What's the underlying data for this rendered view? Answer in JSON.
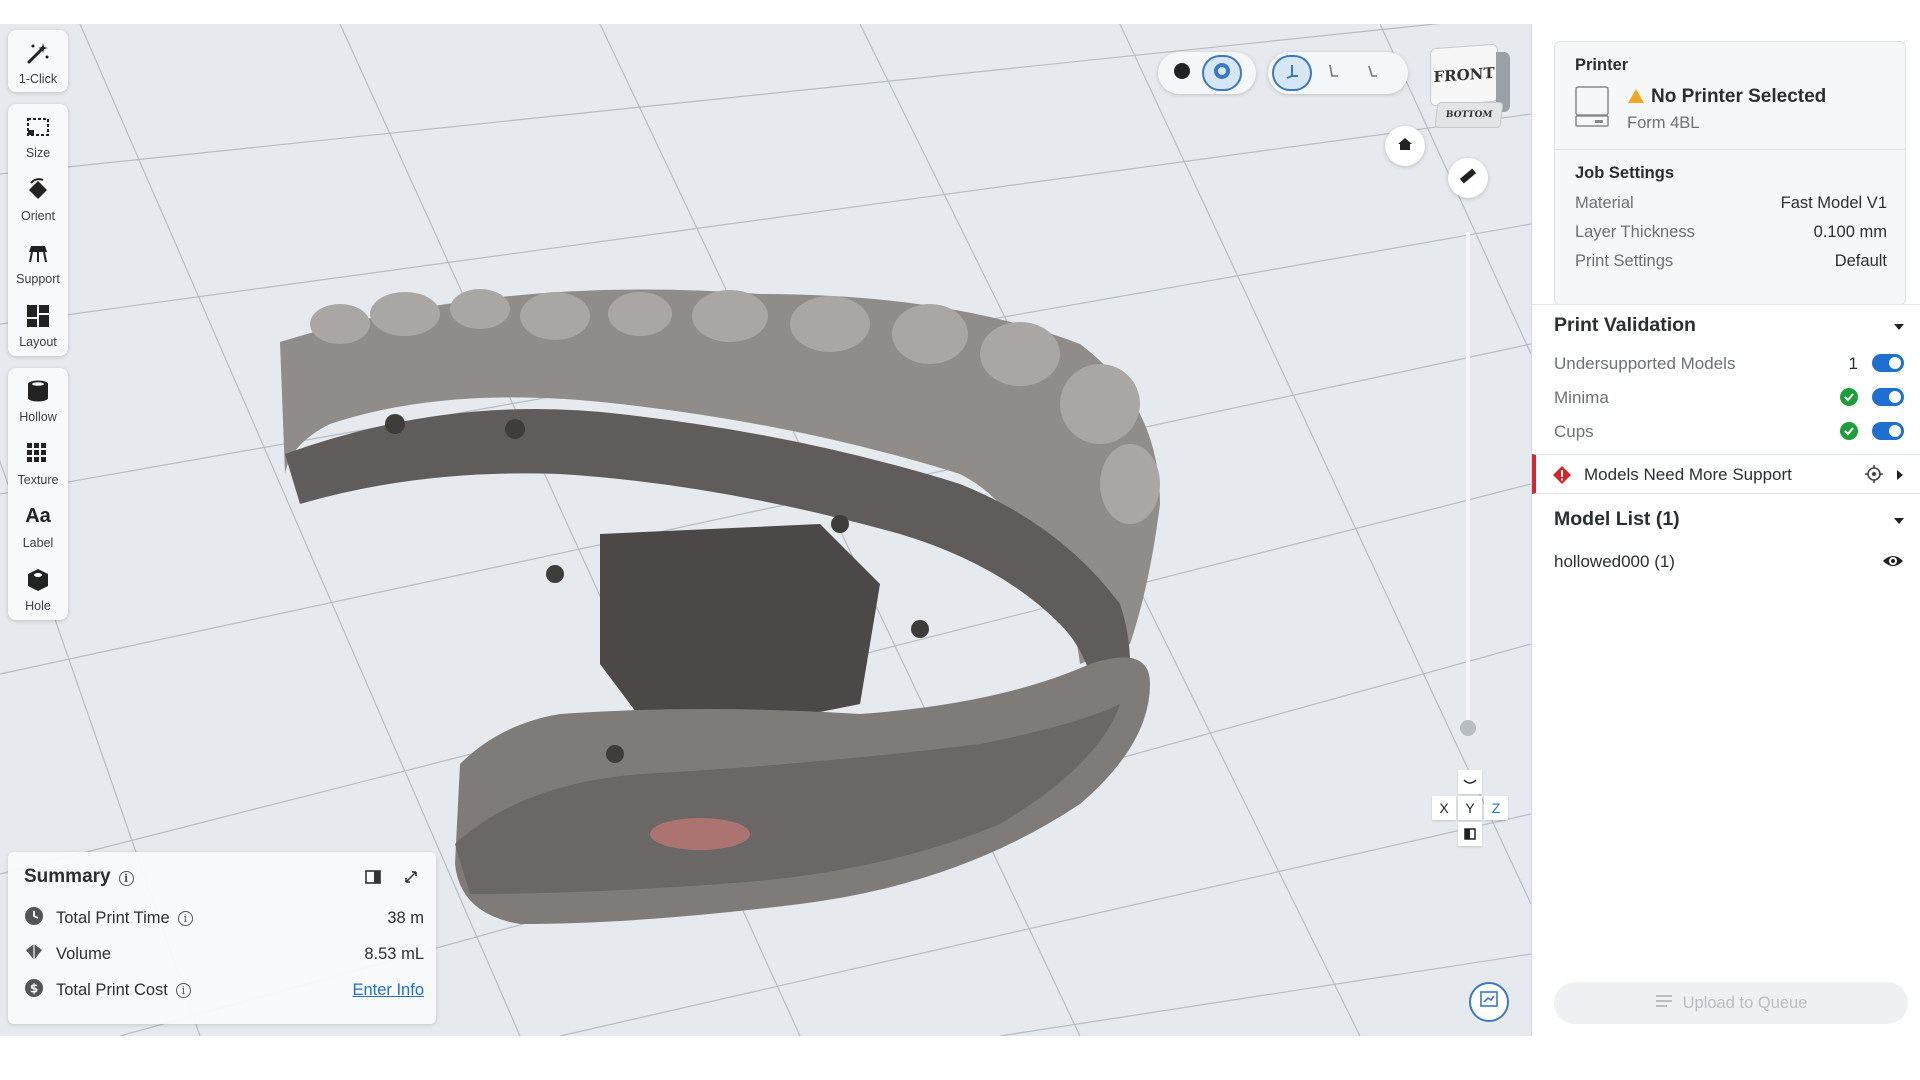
{
  "toolbar": {
    "tools": [
      {
        "label": "1-Click",
        "icon": "magic-wand-icon"
      },
      {
        "label": "Size",
        "icon": "size-icon"
      },
      {
        "label": "Orient",
        "icon": "orient-icon"
      },
      {
        "label": "Support",
        "icon": "support-icon"
      },
      {
        "label": "Layout",
        "icon": "layout-icon"
      },
      {
        "label": "Hollow",
        "icon": "hollow-icon"
      },
      {
        "label": "Texture",
        "icon": "texture-icon"
      },
      {
        "label": "Label",
        "icon": "label-icon",
        "glyph": "Aa"
      },
      {
        "label": "Hole",
        "icon": "hole-icon"
      }
    ]
  },
  "viewcube": {
    "front": "FRONT",
    "bottom": "BOTTOM"
  },
  "axis": {
    "x": "X",
    "y": "Y",
    "z": "Z"
  },
  "summary": {
    "title": "Summary",
    "rows": [
      {
        "label": "Total Print Time",
        "value": "38 m"
      },
      {
        "label": "Volume",
        "value": "8.53 mL"
      },
      {
        "label": "Total Print Cost",
        "value": "Enter Info"
      }
    ]
  },
  "printer": {
    "heading": "Printer",
    "status": "No Printer Selected",
    "model": "Form 4BL",
    "warning_color": "#f5a623"
  },
  "job_settings": {
    "heading": "Job Settings",
    "rows": [
      {
        "label": "Material",
        "value": "Fast Model V1"
      },
      {
        "label": "Layer Thickness",
        "value": "0.100 mm"
      },
      {
        "label": "Print Settings",
        "value": "Default"
      }
    ]
  },
  "validation": {
    "title": "Print Validation",
    "items": [
      {
        "label": "Undersupported Models",
        "count": "1",
        "enabled": true
      },
      {
        "label": "Minima",
        "ok": true,
        "enabled": true
      },
      {
        "label": "Cups",
        "ok": true,
        "enabled": true
      }
    ],
    "alert": "Models Need More Support",
    "alert_color": "#d7262b"
  },
  "model_list": {
    "title": "Model List (1)",
    "items": [
      {
        "name": "hollowed000 (1)",
        "visible": true
      }
    ]
  },
  "upload_label": "Upload to Queue",
  "accent_color": "#1f6fd1"
}
